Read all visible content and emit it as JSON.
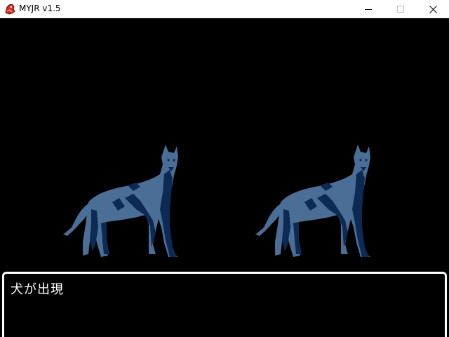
{
  "window": {
    "title": "MYJR v1.5",
    "icon": "red-dragon-app-icon",
    "controls": {
      "minimize_icon": "minimize-icon",
      "maximize_icon": "maximize-icon",
      "close_icon": "close-icon"
    }
  },
  "battle": {
    "background_color": "#000000",
    "enemies": [
      {
        "name": "犬",
        "sprite": "dog-enemy-sprite",
        "color_light": "#4a6e96",
        "color_dark": "#0d2a54"
      },
      {
        "name": "犬",
        "sprite": "dog-enemy-sprite",
        "color_light": "#4a6e96",
        "color_dark": "#0d2a54"
      }
    ]
  },
  "message": {
    "text": "犬が出現"
  }
}
